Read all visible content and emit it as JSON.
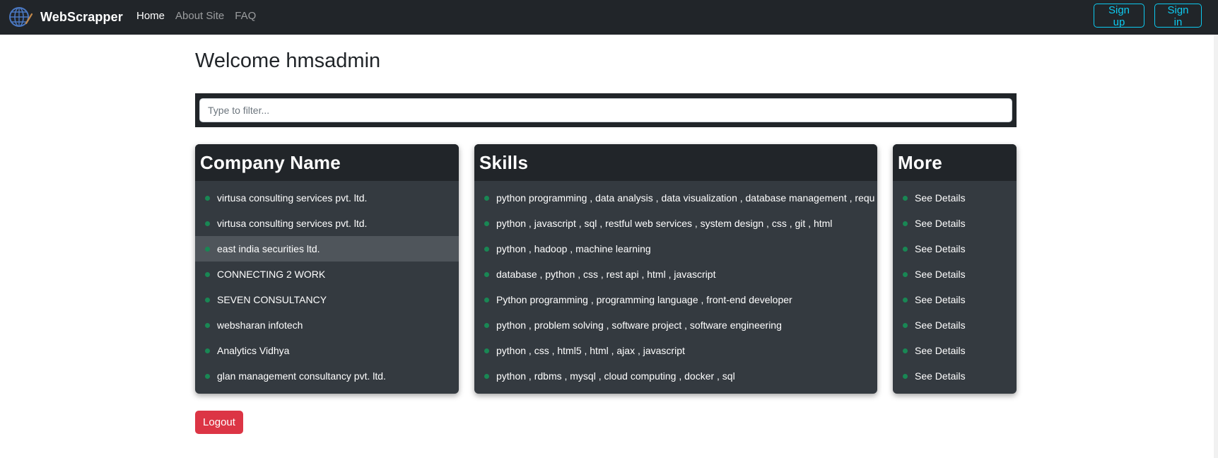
{
  "navbar": {
    "brand": "WebScrapper",
    "links": [
      {
        "label": "Home",
        "active": true
      },
      {
        "label": "About Site",
        "active": false
      },
      {
        "label": "FAQ",
        "active": false
      }
    ],
    "signup_label": "Sign up",
    "signin_label": "Sign in"
  },
  "page": {
    "welcome": "Welcome hmsadmin"
  },
  "filter": {
    "placeholder": "Type to filter...",
    "value": ""
  },
  "columns": {
    "company": {
      "title": "Company Name",
      "items": [
        "virtusa consulting services pvt. ltd.",
        "virtusa consulting services pvt. ltd.",
        "east india securities ltd.",
        "CONNECTING 2 WORK",
        "SEVEN CONSULTANCY",
        "websharan infotech",
        "Analytics Vidhya",
        "glan management consultancy pvt. ltd."
      ]
    },
    "skills": {
      "title": "Skills",
      "items": [
        "python programming , data analysis , data visualization , database management , requ",
        "python , javascript , sql , restful web services , system design , css , git , html",
        "python , hadoop , machine learning",
        "database , python , css , rest api , html , javascript",
        "Python programming , programming language , front-end developer",
        "python , problem solving , software project , software engineering",
        "python , css , html5 , html , ajax , javascript",
        "python , rdbms , mysql , cloud computing , docker , sql"
      ]
    },
    "more": {
      "title": "More",
      "items": [
        "See Details",
        "See Details",
        "See Details",
        "See Details",
        "See Details",
        "See Details",
        "See Details",
        "See Details"
      ]
    }
  },
  "highlighted_row": 2,
  "logout_label": "Logout",
  "colors": {
    "navbar_bg": "#212529",
    "card_bg": "#343a40",
    "accent_outline": "#0dcaf0",
    "bullet": "#198754",
    "logout_bg": "#dc3545"
  },
  "icons": {
    "brand": "globe-scraper-icon",
    "bullet": "dot-icon"
  }
}
